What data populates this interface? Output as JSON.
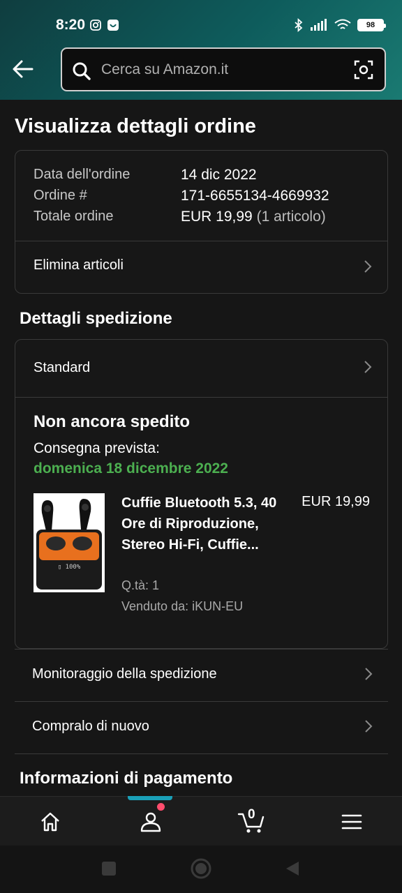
{
  "status_bar": {
    "time": "8:20",
    "battery": "98"
  },
  "search": {
    "placeholder": "Cerca su Amazon.it"
  },
  "page_title": "Visualizza dettagli ordine",
  "order": {
    "date_label": "Data dell'ordine",
    "date_value": "14 dic 2022",
    "number_label": "Ordine #",
    "number_value": "171-6655134-4669932",
    "total_label": "Totale ordine",
    "total_value": "EUR 19,99",
    "total_items": "(1 articolo)",
    "delete_items": "Elimina articoli"
  },
  "shipping": {
    "section_title": "Dettagli spedizione",
    "method": "Standard",
    "status": "Non ancora spedito",
    "delivery_label": "Consegna prevista:",
    "delivery_date": "domenica 18 dicembre 2022",
    "product": {
      "title": "Cuffie Bluetooth 5.3, 40 Ore di Riproduzione, Stereo Hi-Fi, Cuffie...",
      "price": "EUR 19,99",
      "quantity": "Q.tà: 1",
      "seller": "Venduto da: iKUN-EU"
    }
  },
  "actions": {
    "track": "Monitoraggio della spedizione",
    "buy_again": "Compralo di nuovo"
  },
  "payment": {
    "section_title": "Informazioni di pagamento"
  },
  "bottom_nav": {
    "cart_count": "0",
    "items": [
      "home-icon",
      "account-icon",
      "cart-icon",
      "menu-icon"
    ]
  },
  "colors": {
    "accent": "#1aa0b8",
    "delivery_green": "#4caf50",
    "background": "#161616"
  }
}
